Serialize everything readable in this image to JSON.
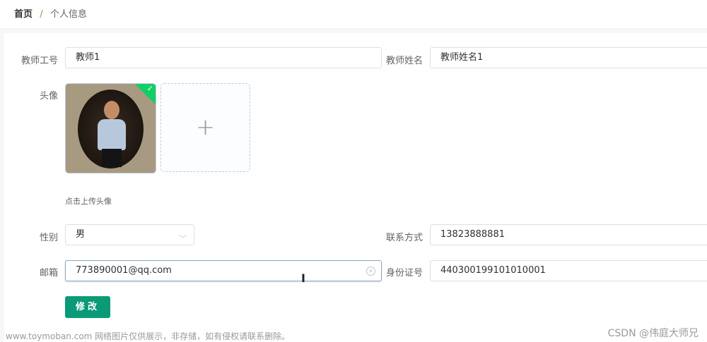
{
  "breadcrumb": {
    "home": "首页",
    "separator": "/",
    "current": "个人信息"
  },
  "form": {
    "teacher_id": {
      "label": "教师工号",
      "value": "教师1"
    },
    "teacher_name": {
      "label": "教师姓名",
      "value": "教师姓名1"
    },
    "avatar": {
      "label": "头像",
      "upload_tip": "点击上传头像"
    },
    "gender": {
      "label": "性别",
      "value": "男"
    },
    "phone": {
      "label": "联系方式",
      "value": "13823888881"
    },
    "email": {
      "label": "邮箱",
      "value": "773890001@qq.com"
    },
    "id_number": {
      "label": "身份证号",
      "value": "440300199101010001"
    },
    "submit_label": "修改"
  },
  "watermark": {
    "left": "www.toymoban.com 网络图片仅供展示，非存储，如有侵权请联系删除。",
    "right": "CSDN @伟庭大师兄"
  },
  "colors": {
    "primary_button": "#0a9a78",
    "success_check": "#13ce66"
  }
}
